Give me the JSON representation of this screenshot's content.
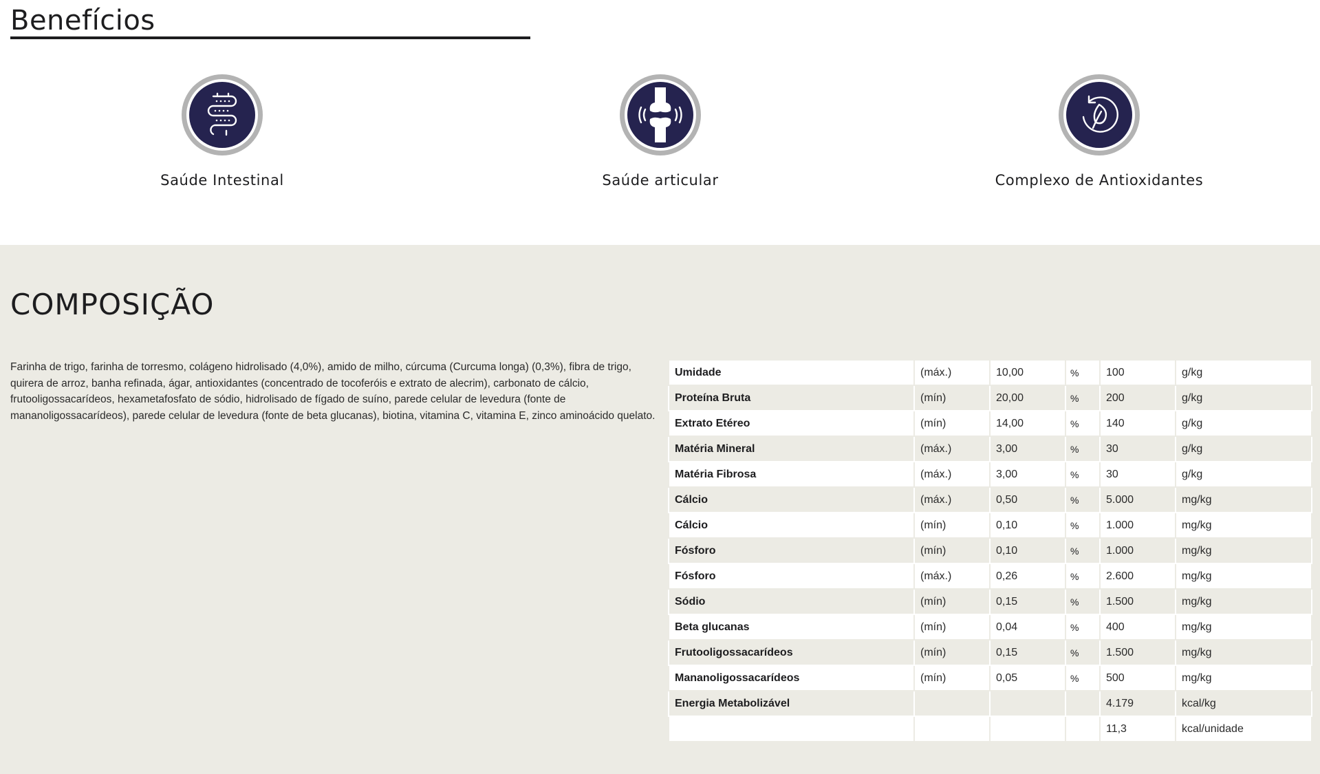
{
  "benefits": {
    "title": "Benefícios",
    "items": [
      {
        "label": "Saúde Intestinal",
        "icon": "intestine-icon"
      },
      {
        "label": "Saúde articular",
        "icon": "joint-icon"
      },
      {
        "label": "Complexo de Antioxidantes",
        "icon": "leaf-cycle-icon"
      }
    ],
    "icon_colors": {
      "ring": "#b3b3b3",
      "core": "#25234f",
      "glyph": "#ffffff"
    }
  },
  "composition": {
    "title": "COMPOSIÇÃO",
    "ingredients": "Farinha de trigo, farinha de torresmo, colágeno hidrolisado (4,0%), amido de milho, cúrcuma (Curcuma longa) (0,3%), fibra de trigo, quirera de arroz, banha refinada, ágar, antioxidantes (concentrado de tocoferóis e extrato de alecrim), carbonato de cálcio, frutooligossacarídeos, hexametafosfato de sódio, hidrolisado de fígado de suíno, parede celular de levedura (fonte de mananoligossacarídeos), parede celular de levedura (fonte de beta glucanas), biotina, vitamina C, vitamina E, zinco aminoácido quelato.",
    "table": [
      {
        "name": "Umidade",
        "limit": "(máx.)",
        "value": "10,00",
        "pct": "%",
        "amount": "100",
        "unit": "g/kg"
      },
      {
        "name": "Proteína Bruta",
        "limit": "(mín)",
        "value": "20,00",
        "pct": "%",
        "amount": "200",
        "unit": "g/kg"
      },
      {
        "name": "Extrato Etéreo",
        "limit": "(mín)",
        "value": "14,00",
        "pct": "%",
        "amount": "140",
        "unit": "g/kg"
      },
      {
        "name": "Matéria Mineral",
        "limit": "(máx.)",
        "value": "3,00",
        "pct": "%",
        "amount": "30",
        "unit": "g/kg"
      },
      {
        "name": "Matéria Fibrosa",
        "limit": "(máx.)",
        "value": "3,00",
        "pct": "%",
        "amount": "30",
        "unit": "g/kg"
      },
      {
        "name": "Cálcio",
        "limit": "(máx.)",
        "value": "0,50",
        "pct": "%",
        "amount": "5.000",
        "unit": "mg/kg"
      },
      {
        "name": "Cálcio",
        "limit": "(mín)",
        "value": "0,10",
        "pct": "%",
        "amount": "1.000",
        "unit": "mg/kg"
      },
      {
        "name": "Fósforo",
        "limit": "(mín)",
        "value": "0,10",
        "pct": "%",
        "amount": "1.000",
        "unit": "mg/kg"
      },
      {
        "name": "Fósforo",
        "limit": "(máx.)",
        "value": "0,26",
        "pct": "%",
        "amount": "2.600",
        "unit": "mg/kg"
      },
      {
        "name": "Sódio",
        "limit": "(mín)",
        "value": "0,15",
        "pct": "%",
        "amount": "1.500",
        "unit": "mg/kg"
      },
      {
        "name": "Beta glucanas",
        "limit": "(mín)",
        "value": "0,04",
        "pct": "%",
        "amount": "400",
        "unit": "mg/kg"
      },
      {
        "name": "Frutooligossacarídeos",
        "limit": "(mín)",
        "value": "0,15",
        "pct": "%",
        "amount": "1.500",
        "unit": "mg/kg"
      },
      {
        "name": "Mananoligossacarídeos",
        "limit": "(mín)",
        "value": "0,05",
        "pct": "%",
        "amount": "500",
        "unit": "mg/kg"
      },
      {
        "name": "Energia Metabolizável",
        "limit": "",
        "value": "",
        "pct": "",
        "amount": "4.179",
        "unit": "kcal/kg"
      },
      {
        "name": "",
        "limit": "",
        "value": "",
        "pct": "",
        "amount": "11,3",
        "unit": "kcal/unidade"
      }
    ]
  }
}
